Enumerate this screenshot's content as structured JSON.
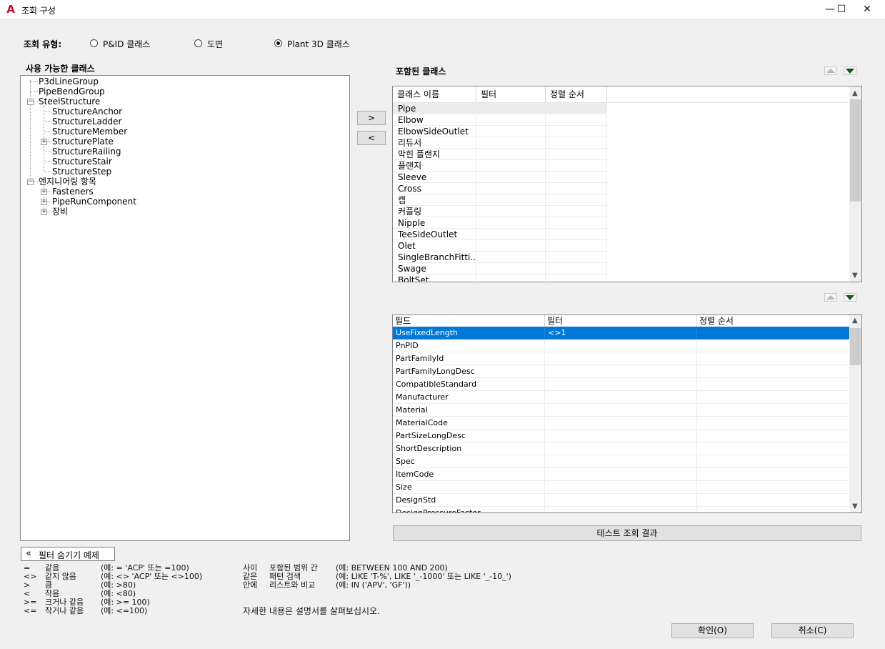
{
  "window": {
    "title": "조회 구성",
    "minimize": "—",
    "maximize": "☐",
    "close": "✕"
  },
  "query_type": {
    "label": "조회 유형:",
    "options": [
      "P&ID 클래스",
      "도면",
      "Plant 3D 클래스"
    ],
    "selected": "Plant 3D 클래스"
  },
  "available": {
    "title": "사용 가능한 클래스",
    "nodes": {
      "p3dlinegroup": "P3dLineGroup",
      "pipebendgroup": "PipeBendGroup",
      "steelstructure": "SteelStructure",
      "structureanchor": "StructureAnchor",
      "structureladder": "StructureLadder",
      "structuremember": "StructureMember",
      "structureplate": "StructurePlate",
      "structurerailing": "StructureRailing",
      "structurestair": "StructureStair",
      "structurestep": "StructureStep",
      "engineering": "엔지니어링 항목",
      "fasteners": "Fasteners",
      "piperuncomponent": "PipeRunComponent",
      "equipment": "장비"
    }
  },
  "transfer": {
    "add": ">",
    "remove": "<"
  },
  "included": {
    "title": "포함된 클래스",
    "headers": [
      "클래스 이름",
      "필터",
      "정렬 순서"
    ],
    "rows": [
      "Pipe",
      "Elbow",
      "ElbowSideOutlet",
      "리듀서",
      "막힌 플랜지",
      "플랜지",
      "Sleeve",
      "Cross",
      "캡",
      "커플링",
      "Nipple",
      "TeeSideOutlet",
      "Olet",
      "SingleBranchFitti...",
      "Swage",
      "BoltSet"
    ]
  },
  "fields": {
    "headers": [
      "필드",
      "필터",
      "정렬 순서"
    ],
    "rows": [
      {
        "field": "UseFixedLength",
        "filter": "<>1"
      },
      {
        "field": "PnPID",
        "filter": ""
      },
      {
        "field": "PartFamilyId",
        "filter": ""
      },
      {
        "field": "PartFamilyLongDesc",
        "filter": ""
      },
      {
        "field": "CompatibleStandard",
        "filter": ""
      },
      {
        "field": "Manufacturer",
        "filter": ""
      },
      {
        "field": "Material",
        "filter": ""
      },
      {
        "field": "MaterialCode",
        "filter": ""
      },
      {
        "field": "PartSizeLongDesc",
        "filter": ""
      },
      {
        "field": "ShortDescription",
        "filter": ""
      },
      {
        "field": "Spec",
        "filter": ""
      },
      {
        "field": "ItemCode",
        "filter": ""
      },
      {
        "field": "Size",
        "filter": ""
      },
      {
        "field": "DesignStd",
        "filter": ""
      },
      {
        "field": "DesignPressureFactor",
        "filter": ""
      }
    ],
    "selected_color": "#0078d7"
  },
  "test_button": "테스트 조회 결과",
  "filter_toggle": {
    "icon": "«",
    "label": "필터 숨기기 예제"
  },
  "legend_left": [
    {
      "op": "=",
      "name": "같음",
      "example": "(예: = 'ACP' 또는 =100)"
    },
    {
      "op": "<>",
      "name": "같지 않음",
      "example": "(예: <> 'ACP' 또는 <>100)"
    },
    {
      "op": ">",
      "name": "큼",
      "example": "(예: >80)"
    },
    {
      "op": "<",
      "name": "작음",
      "example": "(예: <80)"
    },
    {
      "op": ">=",
      "name": "크거나 같음",
      "example": "(예: >= 100)"
    },
    {
      "op": "<=",
      "name": "작거나 같음",
      "example": "(예: <=100)"
    }
  ],
  "legend_right": [
    {
      "op": "사이",
      "name": "포함된 범위 간",
      "example": "(예: BETWEEN 100 AND 200)"
    },
    {
      "op": "같은",
      "name": "패턴 검색",
      "example": "(예: LIKE 'T-%', LIKE '_-1000' 또는 LIKE '_-10_')"
    },
    {
      "op": "안에",
      "name": "리스트와 비교",
      "example": "(예: IN ('APV', 'GF'))"
    }
  ],
  "help_text": "자세한 내용은 설명서를 살펴보십시오.",
  "ok_button": "확인(O)",
  "cancel_button": "취소(C)"
}
